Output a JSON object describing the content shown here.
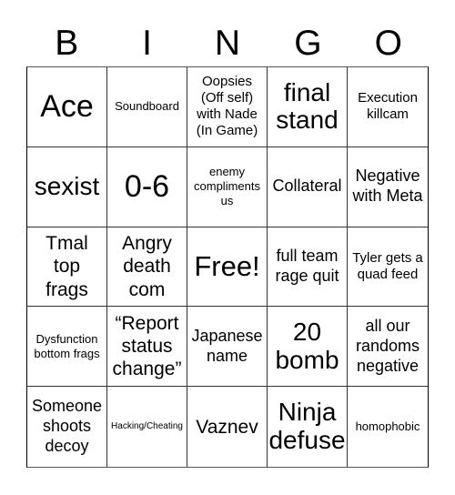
{
  "header": {
    "letters": [
      "B",
      "I",
      "N",
      "G",
      "O"
    ]
  },
  "board": {
    "cells": [
      {
        "text": "Ace",
        "free": false
      },
      {
        "text": "Soundboard",
        "free": false
      },
      {
        "text": "Oopsies (Off self) with Nade (In Game)",
        "free": false
      },
      {
        "text": "final stand",
        "free": false
      },
      {
        "text": "Execution killcam",
        "free": false
      },
      {
        "text": "sexist",
        "free": false
      },
      {
        "text": "0-6",
        "free": false
      },
      {
        "text": "enemy compliments us",
        "free": false
      },
      {
        "text": "Collateral",
        "free": false
      },
      {
        "text": "Negative with Meta",
        "free": false
      },
      {
        "text": "Tmal top frags",
        "free": false
      },
      {
        "text": "Angry death com",
        "free": false
      },
      {
        "text": "Free!",
        "free": true
      },
      {
        "text": "full team rage quit",
        "free": false
      },
      {
        "text": "Tyler gets a quad feed",
        "free": false
      },
      {
        "text": "Dysfunction bottom frags",
        "free": false
      },
      {
        "text": "“Report status change”",
        "free": false
      },
      {
        "text": "Japanese name",
        "free": false
      },
      {
        "text": "20 bomb",
        "free": false
      },
      {
        "text": "all our randoms negative",
        "free": false
      },
      {
        "text": "Someone shoots decoy",
        "free": false
      },
      {
        "text": "Hacking/Cheating",
        "free": false
      },
      {
        "text": "Vaznev",
        "free": false
      },
      {
        "text": "Ninja defuse",
        "free": false
      },
      {
        "text": "homophobic",
        "free": false
      }
    ]
  }
}
